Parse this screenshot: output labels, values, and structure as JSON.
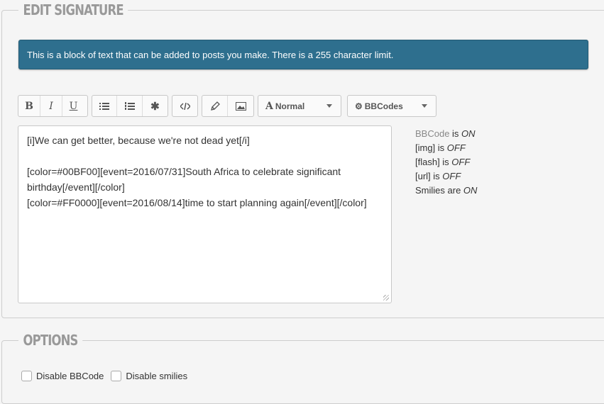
{
  "signature": {
    "legend": "EDIT SIGNATURE",
    "notice": "This is a block of text that can be added to posts you make. There is a 255 character limit.",
    "toolbar": {
      "bold_label": "B",
      "italic_label": "I",
      "underline_label": "U",
      "font_size": "Normal",
      "bbcodes": "BBCodes"
    },
    "editor_text": "[i]We can get better, because we're not dead yet[/i]\n\n[color=#00BF00][event=2016/07/31]South Africa to celebrate significant birthday[/event][/color]\n[color=#FF0000][event=2016/08/14]time to start planning again[/event][/color]",
    "status": {
      "bbcode_label": "BBCode",
      "bbcode_is": " is ",
      "bbcode_value": "ON",
      "img_label": "[img] is ",
      "img_value": "OFF",
      "flash_label": "[flash] is ",
      "flash_value": "OFF",
      "url_label": "[url] is ",
      "url_value": "OFF",
      "smilies_label": "Smilies are ",
      "smilies_value": "ON"
    }
  },
  "options": {
    "legend": "OPTIONS",
    "disable_bbcode": "Disable BBCode",
    "disable_smilies": "Disable smilies"
  },
  "colors": {
    "notice_bg": "#2e6f8e",
    "legend": "#999999"
  }
}
